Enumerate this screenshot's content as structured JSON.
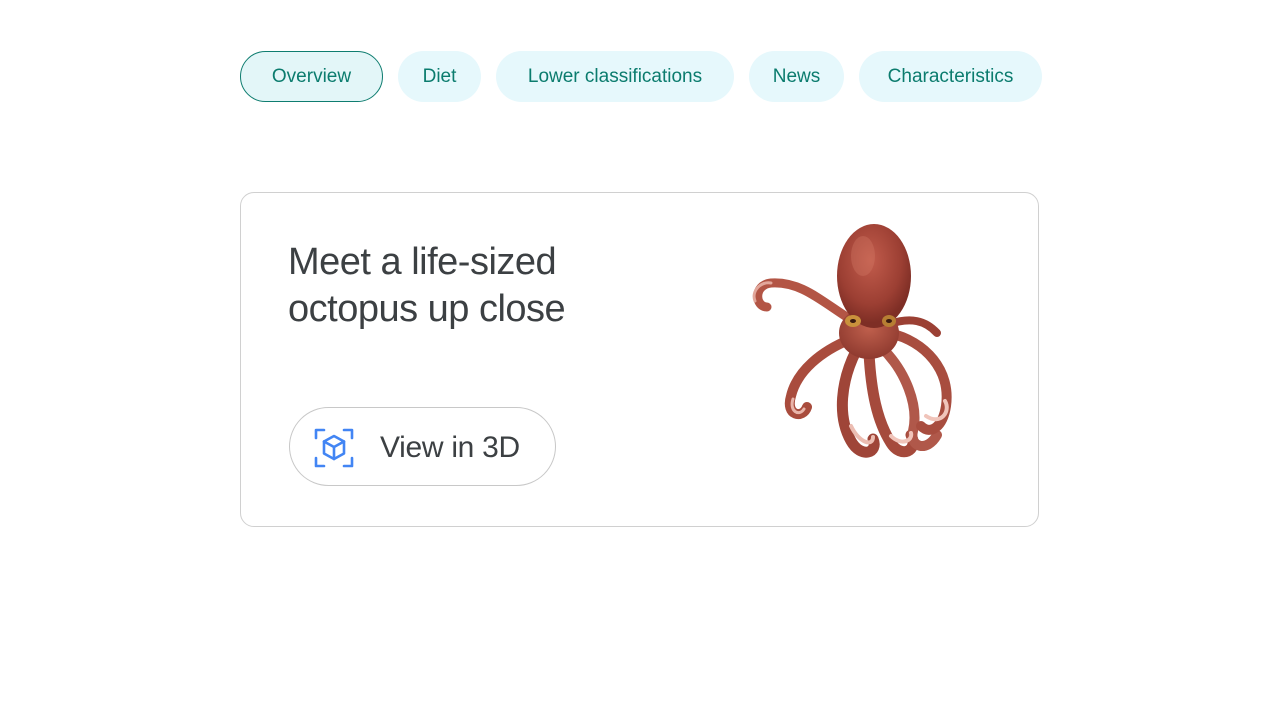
{
  "tabs": [
    {
      "label": "Overview",
      "selected": true
    },
    {
      "label": "Diet",
      "selected": false
    },
    {
      "label": "Lower classifications",
      "selected": false
    },
    {
      "label": "News",
      "selected": false
    },
    {
      "label": "Characteristics",
      "selected": false
    }
  ],
  "card": {
    "headline": "Meet a life-sized octopus up close",
    "button_label": "View in 3D",
    "button_icon": "3d-cube-icon",
    "image_subject": "octopus-3d-model"
  },
  "colors": {
    "chip_bg": "#e6f8fc",
    "chip_text": "#0b7c6e",
    "icon_blue": "#4285f4",
    "text_dark": "#3c4043",
    "octopus": "#a8473a"
  }
}
